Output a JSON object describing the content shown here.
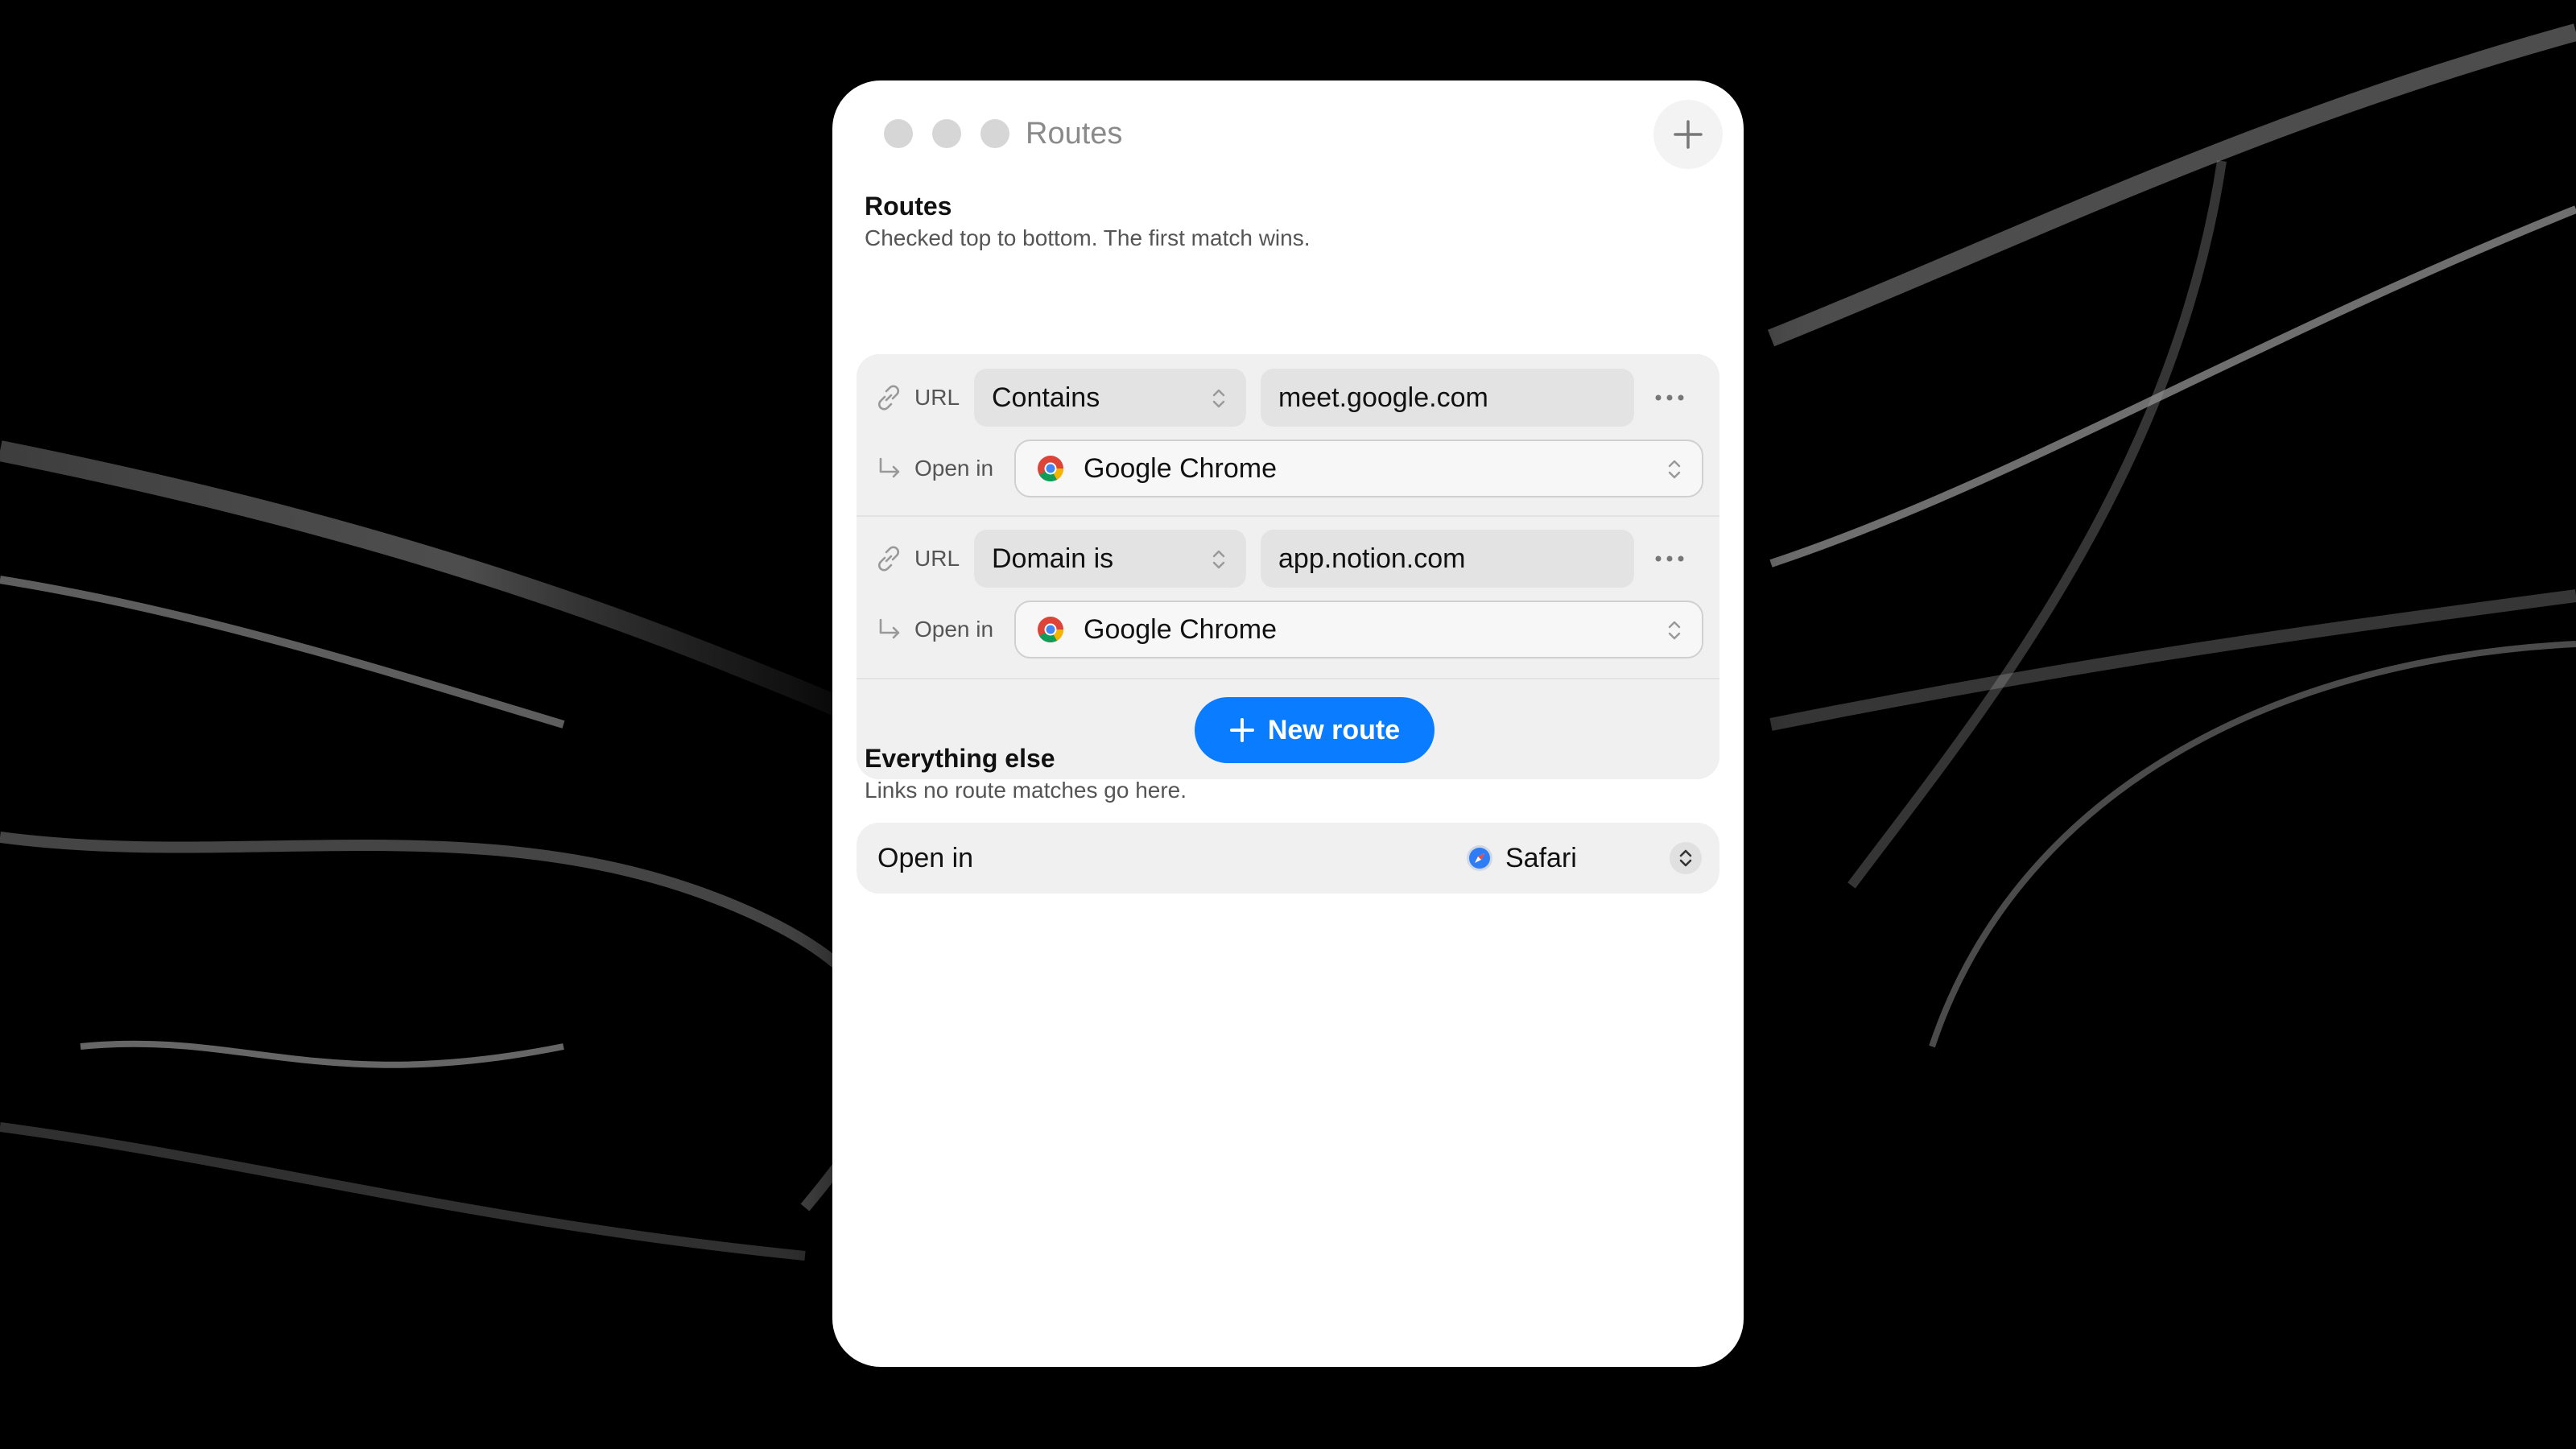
{
  "window": {
    "title": "Routes"
  },
  "routes_section": {
    "title": "Routes",
    "subtitle": "Checked top to bottom. The first match wins.",
    "routes": [
      {
        "url_label": "URL",
        "condition": "Contains",
        "value": "meet.google.com",
        "open_in_label": "Open in",
        "app": "Google Chrome",
        "app_icon": "chrome-icon"
      },
      {
        "url_label": "URL",
        "condition": "Domain is",
        "value": "app.notion.com",
        "open_in_label": "Open in",
        "app": "Google Chrome",
        "app_icon": "chrome-icon"
      }
    ],
    "new_route_label": "New route"
  },
  "fallback_section": {
    "title": "Everything else",
    "subtitle": "Links no route matches go here.",
    "open_in_label": "Open in",
    "app": "Safari",
    "app_icon": "safari-icon"
  },
  "colors": {
    "accent": "#0a7cff",
    "background": "#000000",
    "window": "#ffffff",
    "panel": "#f0f0f0"
  }
}
